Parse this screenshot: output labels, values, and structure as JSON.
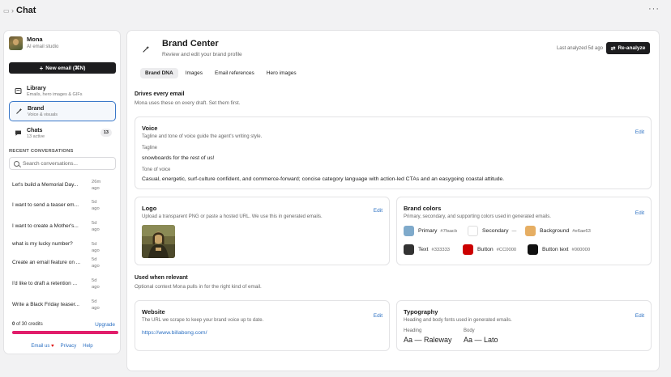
{
  "window": {
    "title": "Chat"
  },
  "profile": {
    "name": "Mona",
    "subtitle": "AI email studio"
  },
  "new_email": {
    "label": "New email (⌘N)"
  },
  "nav": [
    {
      "label": "Library",
      "sub": "Emails, hero images & GIFs"
    },
    {
      "label": "Brand",
      "sub": "Voice & visuals"
    },
    {
      "label": "Chats",
      "sub": "13 active",
      "count": "13"
    }
  ],
  "recent": {
    "title": "RECENT CONVERSATIONS",
    "search_placeholder": "Search conversations...",
    "items": [
      {
        "title": "Let's build a Memorial Day...",
        "time": "26m ago"
      },
      {
        "title": "I want to send a teaser em...",
        "time": "5d ago"
      },
      {
        "title": "I want to create a Mother's...",
        "time": "5d ago"
      },
      {
        "title": "what is my lucky number?",
        "time": "5d ago"
      },
      {
        "title": "Create an email feature on ...",
        "time": "5d ago"
      },
      {
        "title": "I'd like to draft a retention ...",
        "time": "5d ago"
      },
      {
        "title": "Write a Black Friday teaser...",
        "time": "5d ago"
      }
    ]
  },
  "credits": {
    "used": "0",
    "text": "of 30 credits",
    "upgrade": "Upgrade",
    "remaining_fraction": 1.0
  },
  "footer": {
    "email_us": "Email us",
    "privacy": "Privacy",
    "help": "Help"
  },
  "header": {
    "title": "Brand Center",
    "subtitle": "Review and edit your brand profile",
    "last_analyzed": "Last analyzed 5d ago",
    "reanalyze": "Re-analyze"
  },
  "tabs": [
    "Brand DNA",
    "Images",
    "Email references",
    "Hero images"
  ],
  "section_drives": {
    "title": "Drives every email",
    "sub": "Mona uses these on every draft. Set them first."
  },
  "voice": {
    "title": "Voice",
    "sub": "Tagline and tone of voice guide the agent's writing style.",
    "edit": "Edit",
    "tagline_label": "Tagline",
    "tagline": "snowboards for the rest of us!",
    "tone_label": "Tone of voice",
    "tone": "Casual, energetic, surf-culture confident, and commerce-forward; concise category language with action-led CTAs and an easygoing coastal attitude."
  },
  "logo": {
    "title": "Logo",
    "sub": "Upload a transparent PNG or paste a hosted URL. We use this in generated emails.",
    "edit": "Edit"
  },
  "brand_colors": {
    "title": "Brand colors",
    "sub": "Primary, secondary, and supporting colors used in generated emails.",
    "edit": "Edit",
    "colors": [
      {
        "label": "Primary",
        "hex": "#7faacb"
      },
      {
        "label": "Secondary",
        "hex": "—"
      },
      {
        "label": "Background",
        "hex": "#e6ae63"
      },
      {
        "label": "Text",
        "hex": "#333333"
      },
      {
        "label": "Button",
        "hex": "#CC0000"
      },
      {
        "label": "Button text",
        "hex": "#000000"
      }
    ]
  },
  "section_relevant": {
    "title": "Used when relevant",
    "sub": "Optional context Mona pulls in for the right kind of email."
  },
  "website": {
    "title": "Website",
    "sub": "The URL we scrape to keep your brand voice up to date.",
    "edit": "Edit",
    "url": "https://www.billabong.com/"
  },
  "typography": {
    "title": "Typography",
    "sub": "Heading and body fonts used in generated emails.",
    "edit": "Edit",
    "heading_label": "Heading",
    "heading_value": "Aa — Raleway",
    "body_label": "Body",
    "body_value": "Aa — Lato"
  }
}
